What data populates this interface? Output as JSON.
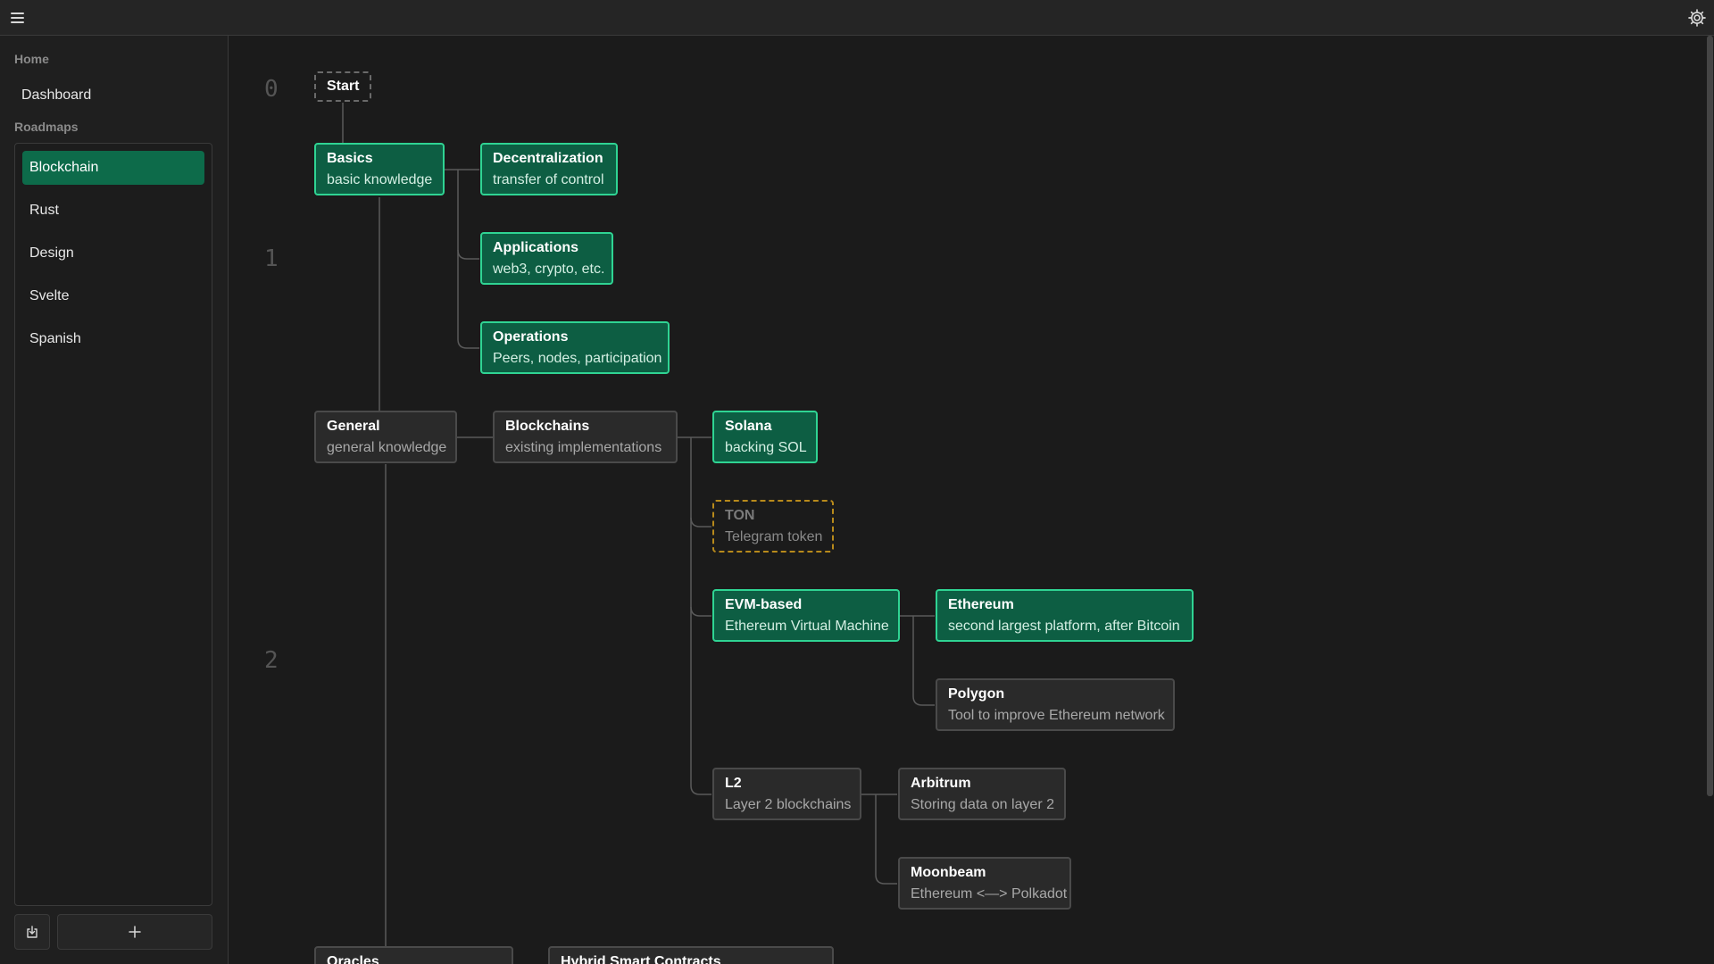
{
  "sidebar": {
    "home_label": "Home",
    "dashboard_label": "Dashboard",
    "roadmaps_label": "Roadmaps",
    "roadmaps": [
      {
        "label": "Blockchain",
        "active": true
      },
      {
        "label": "Rust",
        "active": false
      },
      {
        "label": "Design",
        "active": false
      },
      {
        "label": "Svelte",
        "active": false
      },
      {
        "label": "Spanish",
        "active": false
      }
    ],
    "import_icon": "import-icon",
    "add_icon": "plus-icon"
  },
  "header": {
    "menu_icon": "hamburger-menu-icon",
    "settings_icon": "gear-icon"
  },
  "canvas": {
    "levels": [
      "0",
      "1",
      "2"
    ],
    "nodes": {
      "start": {
        "title": "Start"
      },
      "basics": {
        "title": "Basics",
        "subtitle": "basic knowledge",
        "status": "done"
      },
      "decentralization": {
        "title": "Decentralization",
        "subtitle": "transfer of control",
        "status": "done"
      },
      "applications": {
        "title": "Applications",
        "subtitle": "web3, crypto, etc.",
        "status": "done"
      },
      "operations": {
        "title": "Operations",
        "subtitle": "Peers, nodes, participation",
        "status": "done"
      },
      "general": {
        "title": "General",
        "subtitle": "general knowledge",
        "status": "default"
      },
      "blockchains": {
        "title": "Blockchains",
        "subtitle": "existing implementations",
        "status": "default"
      },
      "solana": {
        "title": "Solana",
        "subtitle": "backing SOL",
        "status": "done"
      },
      "ton": {
        "title": "TON",
        "subtitle": "Telegram token",
        "status": "pending"
      },
      "evm": {
        "title": "EVM-based",
        "subtitle": "Ethereum Virtual Machine",
        "status": "done"
      },
      "ethereum": {
        "title": "Ethereum",
        "subtitle": "second largest platform, after Bitcoin",
        "status": "done"
      },
      "polygon": {
        "title": "Polygon",
        "subtitle": "Tool to improve Ethereum network",
        "status": "default"
      },
      "l2": {
        "title": "L2",
        "subtitle": "Layer 2 blockchains",
        "status": "default"
      },
      "arbitrum": {
        "title": "Arbitrum",
        "subtitle": "Storing data on layer 2",
        "status": "default"
      },
      "moonbeam": {
        "title": "Moonbeam",
        "subtitle": "Ethereum <—> Polkadot",
        "status": "default"
      },
      "oracles": {
        "title": "Oracles",
        "status": "default"
      },
      "hybrid": {
        "title": "Hybrid Smart Contracts",
        "status": "default"
      }
    }
  },
  "colors": {
    "done_fill": "#0d5e43",
    "done_border": "#2fd493",
    "active_item": "#0d6b4a",
    "pending_border": "#b88a1b",
    "background": "#1b1b1b"
  }
}
